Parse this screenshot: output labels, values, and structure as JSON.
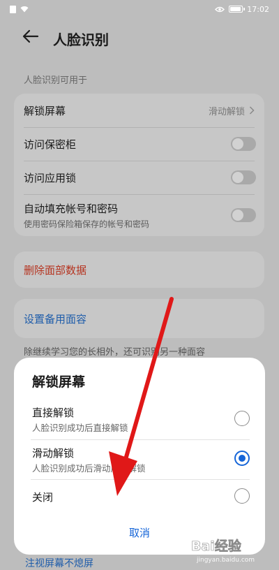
{
  "status_bar": {
    "time": "17:02"
  },
  "header": {
    "title": "人脸识别"
  },
  "section_caption": "人脸识别可用于",
  "settings": {
    "unlock_screen": {
      "label": "解锁屏幕",
      "value": "滑动解锁"
    },
    "access_safe": {
      "label": "访问保密柜",
      "enabled": false
    },
    "access_app_lock": {
      "label": "访问应用锁",
      "enabled": false
    },
    "autofill": {
      "label": "自动填充帐号和密码",
      "sub": "使用密码保险箱保存的帐号和密码",
      "enabled": false
    }
  },
  "delete_face": {
    "label": "删除面部数据"
  },
  "backup_face": {
    "label": "设置备用面容"
  },
  "backup_desc": "除继续学习您的长相外，还可识别另一种面容",
  "bottom_peek": "注视屏幕不熄屏",
  "dialog": {
    "title": "解锁屏幕",
    "options": [
      {
        "label": "直接解锁",
        "sub": "人脸识别成功后直接解锁",
        "selected": false
      },
      {
        "label": "滑动解锁",
        "sub": "人脸识别成功后滑动屏幕解锁",
        "selected": true
      },
      {
        "label": "关闭",
        "sub": "",
        "selected": false
      }
    ],
    "cancel": "取消"
  },
  "watermark": {
    "main": "Bai经验",
    "sub": "jingyan.baidu.com"
  },
  "colors": {
    "accent": "#1565d8",
    "danger": "#b5331f",
    "annotation_arrow": "#e01818"
  },
  "icons": [
    "sim-icon",
    "wifi-icon",
    "eye-icon",
    "battery-icon",
    "back-arrow-icon",
    "chevron-right-icon",
    "radio-icon",
    "annotation-arrow",
    "baidu-watermark-logo"
  ],
  "battery_level": 0.8
}
